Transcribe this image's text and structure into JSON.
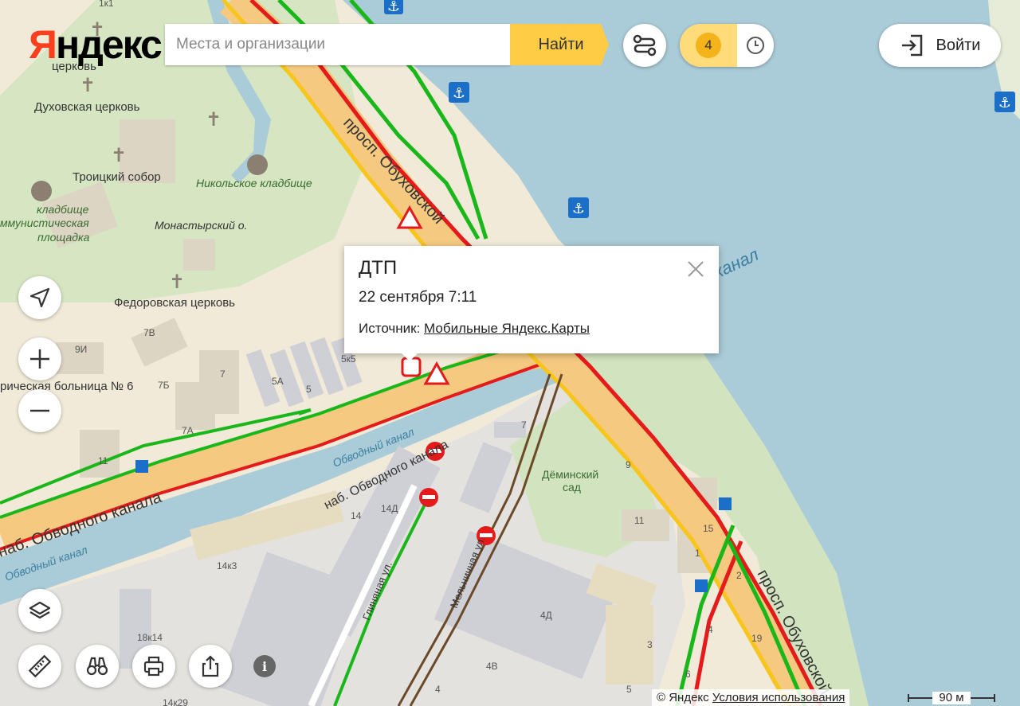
{
  "header": {
    "logo": {
      "first_letter": "Я",
      "rest": "ндекс"
    },
    "search": {
      "placeholder": "Места и организации",
      "button_label": "Найти"
    },
    "traffic": {
      "score": "4"
    },
    "login_label": "Войти"
  },
  "popup": {
    "title": "ДТП",
    "date": "22 сентября 7:11",
    "source_label": "Источник:",
    "source_link": "Мобильные Яндекс.Карты"
  },
  "footer": {
    "copyright": "© Яндекс",
    "terms_link": "Условия использования",
    "scale_label": "90 м"
  },
  "map_labels": {
    "church1": "Духовская церковь",
    "church2": "Троицкий собор",
    "church3": "Федоровская церковь",
    "church_top": "церковь",
    "cemetery1": "Никольское кладбище",
    "cemetery2_a": "кладбище",
    "cemetery2_b": "ммунистическая",
    "cemetery2_c": "площадка",
    "island": "Монастырский о.",
    "hospital": "рическая больница № 6",
    "prosp_obuhovskoy_top": "просп. Обуховской",
    "prosp_obuhovskoy_bottom": "просп. Обуховской",
    "nab_obvodnogo_big": "наб. Обводного канала",
    "nab_obvodnogo_small": "наб. Обводного канала",
    "canal1": "Обводный канал",
    "canal2": "Обводный канал",
    "canal_right": "канал",
    "street_glinyanaya": "Глиняная ул.",
    "street_melnichnaya": "Мельничная ул.",
    "garden_a": "Дёминский",
    "garden_b": "сад",
    "h_9i": "9И",
    "h_7v": "7В",
    "h_7b": "7Б",
    "h_7": "7",
    "h_7a": "7А",
    "h_11": "11",
    "h_5a": "5А",
    "h_5": "5",
    "h_5k5": "5к5",
    "h_14": "14",
    "h_14d": "14Д",
    "h_14k3": "14к3",
    "h_18k14": "18к14",
    "h_14k29": "14к29",
    "h_7b2": "7",
    "h_9": "9",
    "h_11r": "11",
    "h_1": "1",
    "h_15": "15",
    "h_2": "2",
    "h_4": "4",
    "h_19": "19",
    "h_6": "6",
    "h_4d": "4Д",
    "h_4v": "4В",
    "h_4b": "4",
    "h_3": "3",
    "h_5b": "5",
    "h_1k1": "1к1"
  },
  "icons": {
    "route": "route-icon",
    "clock": "clock-icon",
    "login": "login-icon",
    "close": "close-icon",
    "navigate": "navigation-arrow-icon",
    "zoom_in": "plus-icon",
    "zoom_out": "minus-icon",
    "layers": "layers-icon",
    "ruler": "ruler-icon",
    "panorama": "binoculars-icon",
    "print": "printer-icon",
    "share": "share-icon",
    "info": "info-icon"
  },
  "colors": {
    "brand_red": "#fc3f1d",
    "search_button": "#ffcc44",
    "traffic_green": "#1ab71a",
    "traffic_yellow": "#f7c51b",
    "traffic_red": "#e51a1a",
    "water": "#aacbd8"
  }
}
